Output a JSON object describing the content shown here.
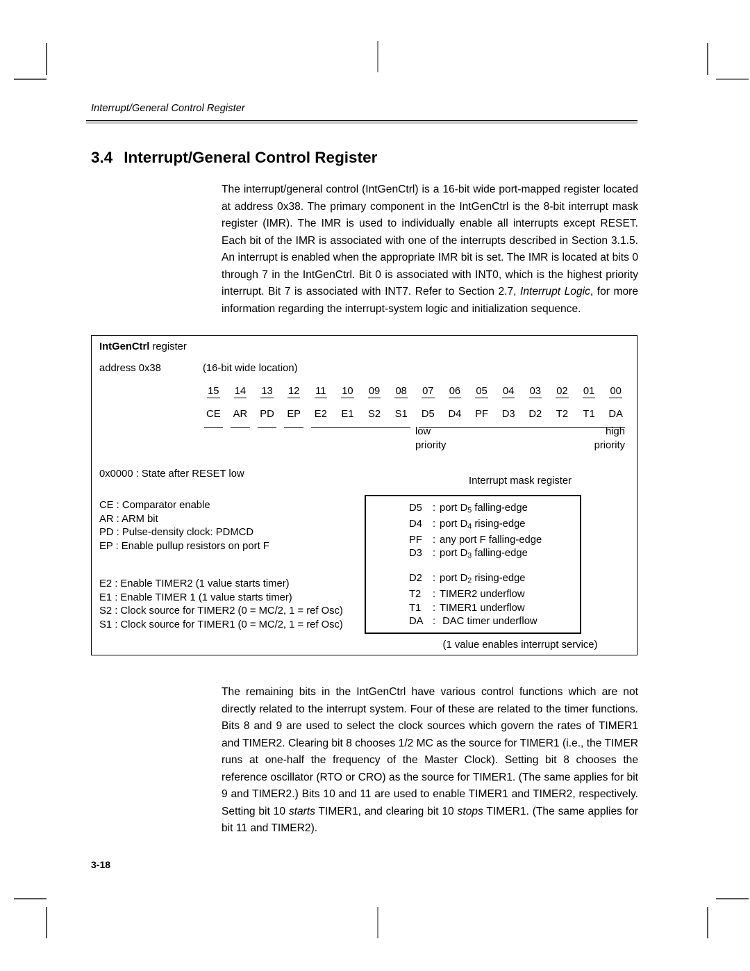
{
  "running_head": "Interrupt/General Control Register",
  "section": {
    "number": "3.4",
    "title": "Interrupt/General Control Register"
  },
  "paragraphs": {
    "intro_a": "The interrupt/general control (IntGenCtrl) is a 16-bit wide port-mapped register located at address 0x38. The primary component in the IntGenCtrl is the 8-bit interrupt mask register (IMR). The IMR is used to individually enable all interrupts except RESET. Each bit of the IMR is associated with one of the interrupts described in Section 3.1.5. An interrupt is enabled when the appropriate IMR bit is set. The IMR is located at bits 0 through 7 in the IntGenCtrl. Bit 0 is associated with INT0, which is the highest priority interrupt. Bit 7 is associated with INT7. Refer to Section 2.7, ",
    "intro_italic": "Interrupt Logic",
    "intro_b": ", for more information regarding the interrupt-system logic and initialization sequence.",
    "remaining_a": "The remaining bits in the IntGenCtrl have various control functions which are not directly related to the interrupt system. Four of these are related to the timer functions. Bits 8 and 9 are used to select the clock sources which govern the rates of TIMER1 and TIMER2. Clearing bit 8 chooses 1/2 MC as the source for TIMER1 (i.e., the TIMER runs at one-half the frequency of the Master Clock). Setting bit 8 chooses the reference oscillator (RTO or CRO) as the source for TIMER1. (The same applies for bit 9 and TIMER2.) Bits 10 and 11 are used to enable TIMER1 and TIMER2, respectively. Setting bit 10 ",
    "remaining_italic_1": "starts",
    "remaining_b": " TIMER1, and clearing bit 10 ",
    "remaining_italic_2": "stops",
    "remaining_c": " TIMER1. (The same applies for bit 11 and TIMER2)."
  },
  "figure": {
    "register_name": "IntGenCtrl",
    "register_name_suffix": " register",
    "address_label": "address 0x38",
    "width_label": "(16-bit wide location)",
    "bit_numbers": [
      "15",
      "14",
      "13",
      "12",
      "11",
      "10",
      "09",
      "08",
      "07",
      "06",
      "05",
      "04",
      "03",
      "02",
      "01",
      "00"
    ],
    "bit_names": [
      "CE",
      "AR",
      "PD",
      "EP",
      "E2",
      "E1",
      "S2",
      "S1",
      "D5",
      "D4",
      "PF",
      "D3",
      "D2",
      "T2",
      "T1",
      "DA"
    ],
    "priority_low": "low\npriority",
    "priority_low_l1": "low",
    "priority_low_l2": "priority",
    "priority_high_l1": "high",
    "priority_high_l2": "priority",
    "reset_state": "0x0000 : State after RESET low",
    "legend_group_a": [
      "CE : Comparator enable",
      "AR : ARM bit",
      "PD : Pulse-density clock: PDMCD",
      "EP : Enable pullup resistors on port F"
    ],
    "legend_group_b": [
      "E2 : Enable TIMER2 (1 value starts timer)",
      "E1 : Enable TIMER 1 (1 value starts timer)",
      "S2 : Clock source for TIMER2 (0 = MC/2, 1 = ref Osc)",
      "S1 : Clock source for TIMER1 (0 = MC/2, 1 = ref Osc)"
    ],
    "imr_title": "Interrupt mask register",
    "imr_group_a": [
      {
        "key": "D5",
        "sep": ":",
        "pre": "port D",
        "sub": "5",
        "post": " falling-edge"
      },
      {
        "key": "D4",
        "sep": ":",
        "pre": "port D",
        "sub": "4",
        "post": " rising-edge"
      },
      {
        "key": "PF",
        "sep": ":",
        "pre": "any port F falling-edge",
        "sub": "",
        "post": ""
      },
      {
        "key": "D3",
        "sep": ":",
        "pre": "port D",
        "sub": "3",
        "post": " falling-edge"
      }
    ],
    "imr_group_b": [
      {
        "key": "D2",
        "sep": ":",
        "pre": "port D",
        "sub": "2",
        "post": " rising-edge"
      },
      {
        "key": "T2",
        "sep": ":",
        "pre": "TIMER2 underflow",
        "sub": "",
        "post": ""
      },
      {
        "key": "T1",
        "sep": ":",
        "pre": "TIMER1 underflow",
        "sub": "",
        "post": ""
      },
      {
        "key": "DA",
        "sep": ":",
        "pre": " DAC timer underflow",
        "sub": "",
        "post": ""
      }
    ],
    "imr_note": "(1 value enables interrupt service)"
  },
  "folio": "3-18",
  "colors": {
    "ink": "#000000",
    "rule_fill": "#c8c8c8",
    "cropmark": "#555555",
    "page": "#ffffff"
  }
}
